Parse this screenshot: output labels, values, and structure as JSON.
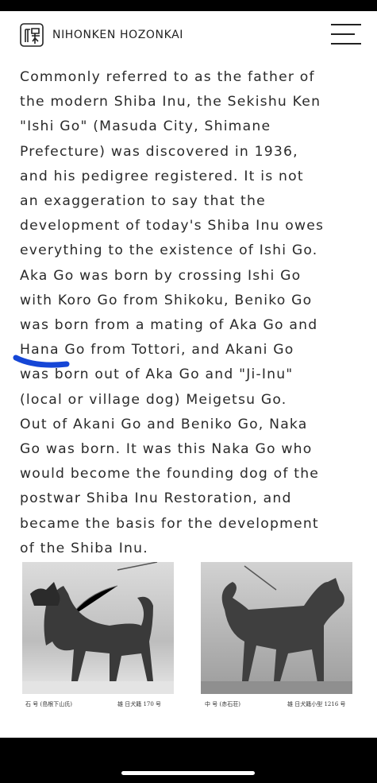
{
  "site": {
    "title": "NIHONKEN HOZONKAI",
    "logo_icon": "nihonken-hozonkai-logo",
    "menu_icon": "hamburger-menu-icon"
  },
  "article": {
    "lines": [
      "Commonly referred to as the father of",
      "the modern Shiba Inu, the Sekishu Ken",
      "\"Ishi Go\" (Masuda City, Shimane",
      "Prefecture) was discovered in 1936,",
      "and his pedigree registered. It is not",
      "an exaggeration to say that the",
      "development of today's Shiba Inu owes",
      "everything to the existence of Ishi Go.",
      "Aka Go was born by crossing Ishi Go",
      "with Koro Go from Shikoku, Beniko Go",
      "was born from a mating of Aka Go and",
      "Hana Go from Tottori, and Akani Go",
      "was born out of Aka Go and \"Ji-Inu\"",
      "(local or village dog) Meigetsu Go.",
      "Out of Akani Go and Beniko Go, Naka",
      "Go was born. It was this Naka Go who",
      "would become the founding dog of the",
      "postwar Shiba Inu Restoration, and",
      "became the basis for the development",
      "of the Shiba Inu."
    ]
  },
  "photos": [
    {
      "name_jp": "石 号",
      "owner_jp": "(島根下山氏)",
      "sex_jp": "雄",
      "reg_jp": "日犬籍 170 号"
    },
    {
      "name_jp": "中 号",
      "owner_jp": "(赤石荘)",
      "sex_jp": "雄",
      "reg_jp": "日犬籍小型 1216 号"
    }
  ],
  "colors": {
    "text": "#2a2a2a",
    "scribble": "#1546d6",
    "bars": "#000000"
  }
}
